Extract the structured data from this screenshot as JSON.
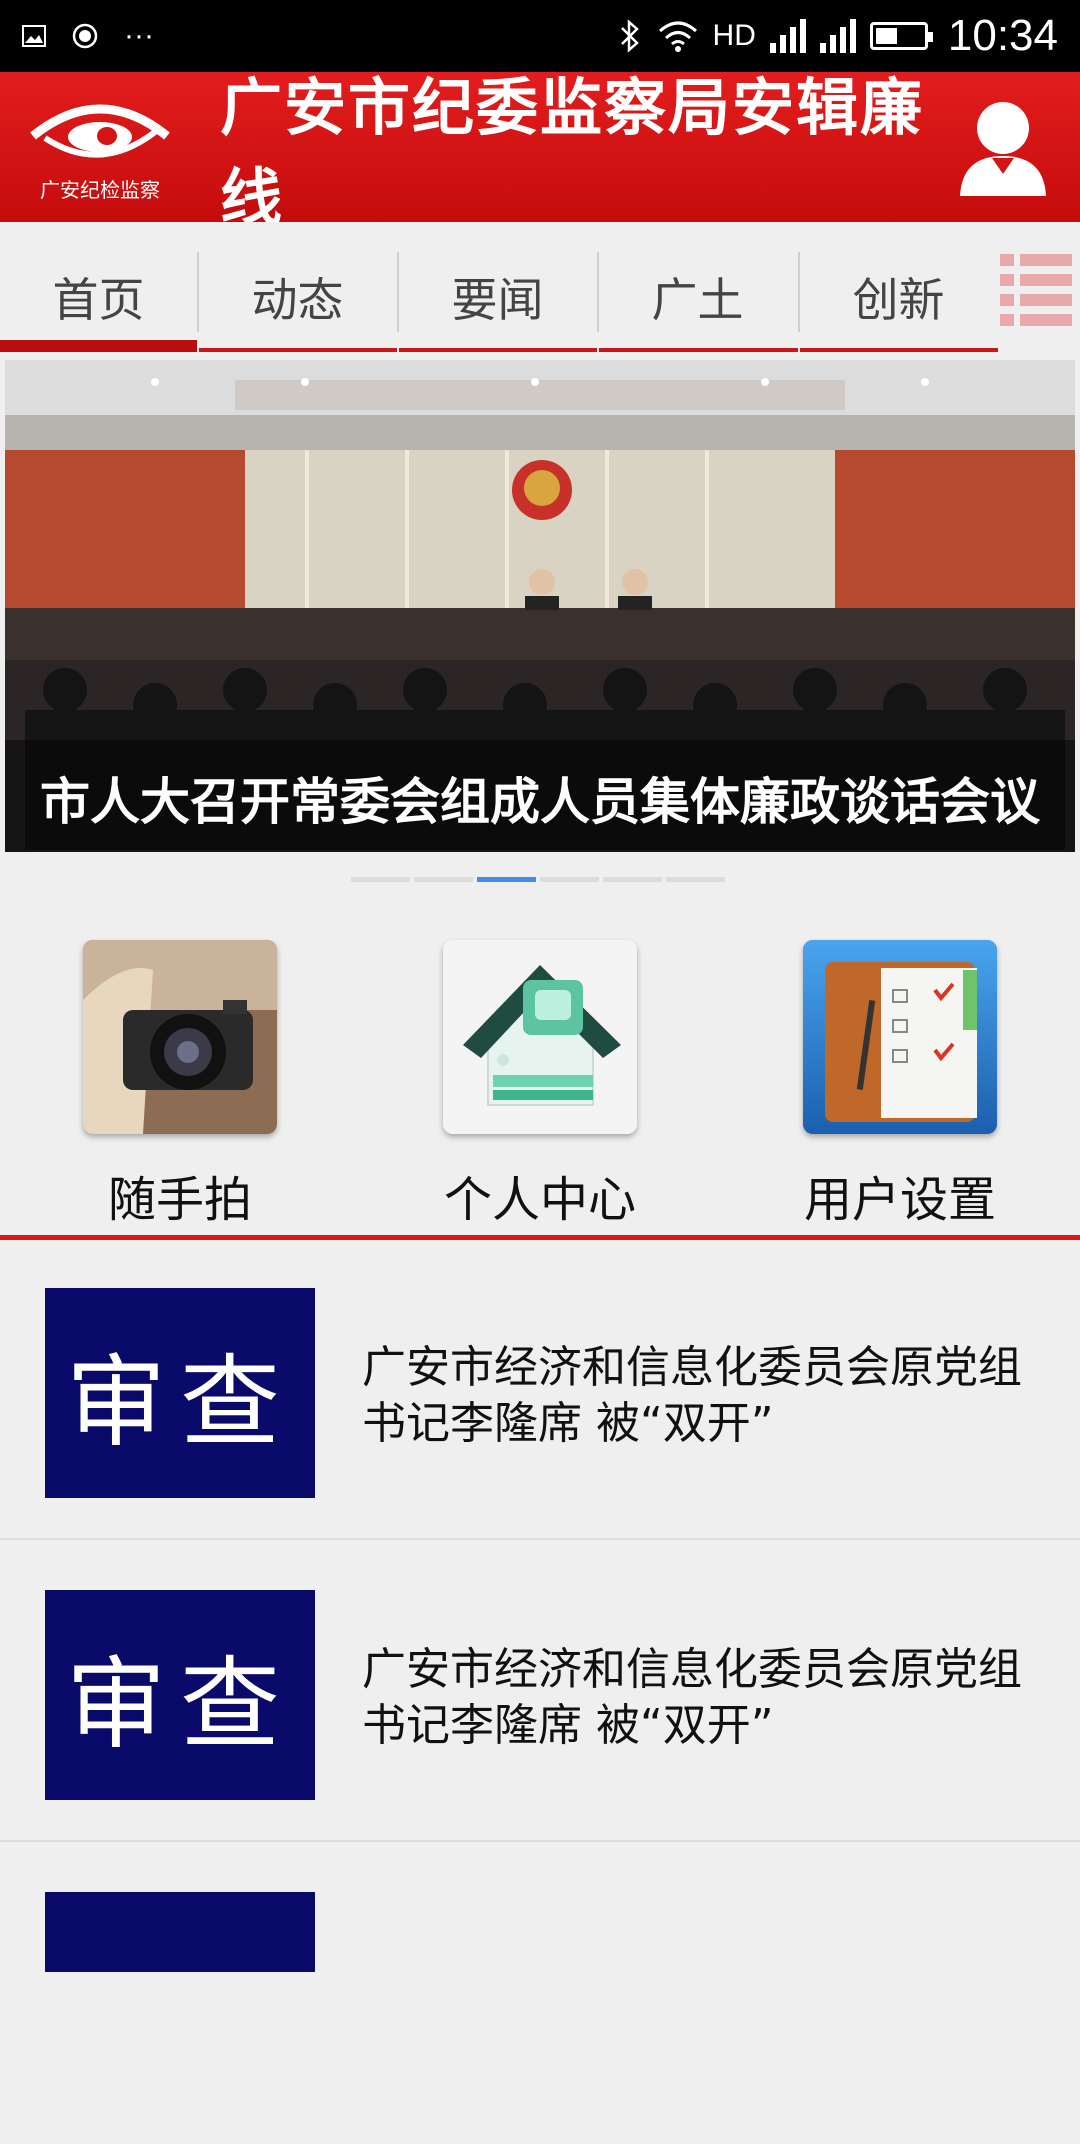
{
  "status_bar": {
    "network": "HD",
    "time": "10:34",
    "battery_level": 0.45
  },
  "header": {
    "logo_text": "广安纪检监察",
    "title": "广安市纪委监察局安辑廉线"
  },
  "tabs": [
    {
      "label": "首页",
      "active": true
    },
    {
      "label": "动态",
      "active": false
    },
    {
      "label": "要闻",
      "active": false
    },
    {
      "label": "广土",
      "active": false
    },
    {
      "label": "创新",
      "active": false
    }
  ],
  "banner": {
    "caption": "市人大召开常委会组成人员集体廉政谈话会议",
    "page_count": 6,
    "active_index": 2
  },
  "quick_actions": [
    {
      "label": "随手拍",
      "icon": "camera-icon"
    },
    {
      "label": "个人中心",
      "icon": "house-icon"
    },
    {
      "label": "用户设置",
      "icon": "notebook-icon"
    }
  ],
  "news": [
    {
      "thumb": "审查",
      "title": "广安市经济和信息化委员会原党组书记李隆席 被“双开”"
    },
    {
      "thumb": "审查",
      "title": "广安市经济和信息化委员会原党组书记李隆席 被“双开”"
    }
  ],
  "colors": {
    "brand_red": "#d41414",
    "thumb_blue": "#0a0a6a",
    "dot_active": "#3f8fe0"
  }
}
